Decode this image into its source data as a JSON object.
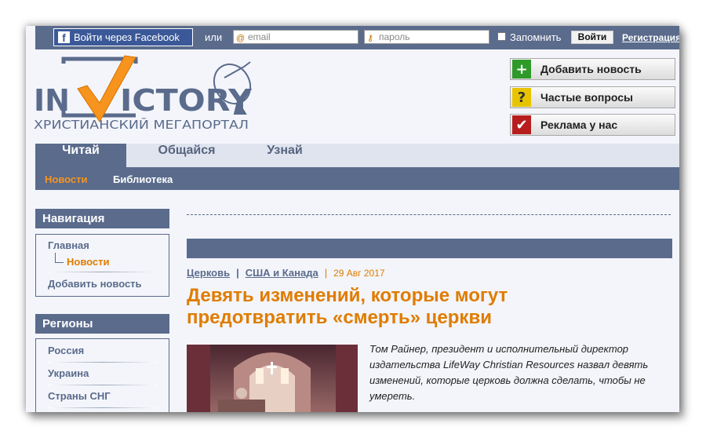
{
  "topbar": {
    "facebook_label": "Войти через Facebook",
    "or_label": "или",
    "email_placeholder": "email",
    "password_placeholder": "пароль",
    "remember_label": "Запомнить",
    "login_label": "Войти",
    "register_label": "Регистрация"
  },
  "logo": {
    "wordmark_left": "IN",
    "wordmark_right": "ICTORY",
    "tagline": "ХРИСТИАНСКИЙ МЕГАПОРТАЛ"
  },
  "side_buttons": {
    "add_news": "Добавить новость",
    "faq": "Частые вопросы",
    "ads": "Реклама у нас"
  },
  "main_nav": [
    "Читай",
    "Общайся",
    "Узнай"
  ],
  "sub_nav": [
    "Новости",
    "Библиотека"
  ],
  "sidebar": {
    "nav_title": "Навигация",
    "nav_items": [
      "Главная",
      "Новости",
      "Добавить новость"
    ],
    "regions_title": "Регионы",
    "region_items": [
      "Россия",
      "Украина",
      "Страны СНГ"
    ]
  },
  "article": {
    "category": "Церковь",
    "region": "США и Канада",
    "date": "29 Авг 2017",
    "headline": "Девять изменений, которые могут предотвратить «смерть» церкви",
    "lead": "Том Райнер, президент и исполнительный директор издательства LifeWay Christian Resources назвал девять изменений, которые церковь должна сделать, чтобы не умереть."
  },
  "colors": {
    "brand": "#5a6b8c",
    "accent": "#e07c00",
    "facebook": "#3b5998"
  }
}
